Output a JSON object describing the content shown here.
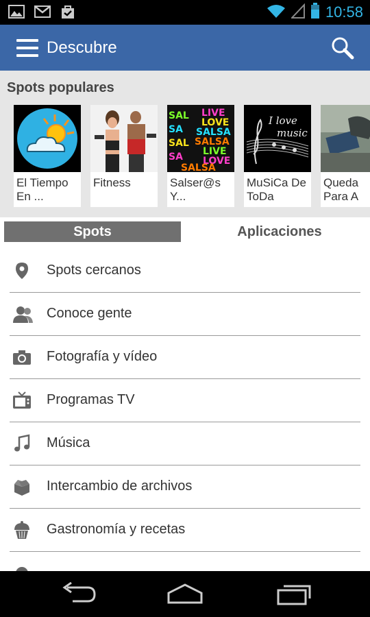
{
  "status_bar": {
    "time": "10:58"
  },
  "app_bar": {
    "title": "Descubre"
  },
  "popular": {
    "heading": "Spots populares",
    "cards": [
      {
        "label": "El Tiempo\nEn ..."
      },
      {
        "label": "Fitness"
      },
      {
        "label": "Salser@s\nY..."
      },
      {
        "label": "MuSiCa De\nToDa"
      },
      {
        "label": "Queda\nPara A"
      }
    ]
  },
  "tabs": {
    "spots": "Spots",
    "apps": "Aplicaciones"
  },
  "menu": [
    {
      "label": "Spots cercanos",
      "icon": "location-pin-icon"
    },
    {
      "label": "Conoce gente",
      "icon": "people-icon"
    },
    {
      "label": "Fotografía y vídeo",
      "icon": "camera-icon"
    },
    {
      "label": "Programas TV",
      "icon": "tv-icon"
    },
    {
      "label": "Música",
      "icon": "music-note-icon"
    },
    {
      "label": "Intercambio de archivos",
      "icon": "box-icon"
    },
    {
      "label": "Gastronomía y recetas",
      "icon": "cupcake-icon"
    }
  ],
  "colors": {
    "appbar": "#3b67a7",
    "clock": "#33b5e5",
    "active_tab": "#707070"
  }
}
